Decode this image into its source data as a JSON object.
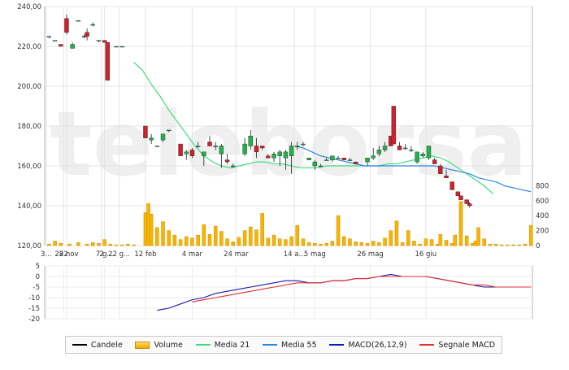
{
  "chart_data": {
    "type": "candlestick",
    "watermark": "teleborsa",
    "colors": {
      "up": "#22b24c",
      "down": "#d0202a",
      "volume_fill": "#f7b500",
      "media21": "#3ddc84",
      "media55": "#2e86de",
      "macd": "#1a1aa6",
      "signal": "#e03030"
    },
    "price_axis": {
      "min": 120,
      "max": 240,
      "ticks": [
        "120,00",
        "140,00",
        "160,00",
        "180,00",
        "200,00",
        "220,00",
        "240,00"
      ]
    },
    "volume_axis": {
      "min": 0,
      "max": 1000,
      "ticks": [
        "0",
        "200",
        "400",
        "600",
        "800"
      ]
    },
    "macd_axis": {
      "min": -20,
      "max": 5,
      "ticks": [
        "5",
        "0",
        "-5",
        "-10",
        "-15",
        "-20"
      ]
    },
    "x_labels": [
      "3...",
      "22",
      "28 nov",
      "2",
      "7 g...",
      "22 g...",
      "12 feb",
      "4 mar",
      "24 mar",
      "14 a...",
      "5 mag",
      "26 mag",
      "16 giu"
    ],
    "x_label_index": [
      0,
      6,
      7,
      19,
      20,
      25,
      34,
      50,
      65,
      85,
      92,
      111,
      130
    ],
    "num_sessions": 146,
    "candles": [
      [
        1,
        225,
        225,
        224,
        225
      ],
      [
        3,
        223,
        223,
        223,
        223
      ],
      [
        5,
        221,
        221,
        220,
        220
      ],
      [
        7,
        234,
        236,
        226,
        227
      ],
      [
        9,
        219,
        222,
        219,
        221
      ],
      [
        11,
        233,
        233,
        233,
        233
      ],
      [
        13,
        225,
        226,
        224,
        225
      ],
      [
        14,
        227,
        229,
        223,
        225
      ],
      [
        16,
        231,
        232,
        230,
        231
      ],
      [
        18,
        223,
        223,
        222,
        223
      ],
      [
        20,
        223,
        223,
        222,
        222
      ],
      [
        21,
        222,
        222,
        203,
        203
      ],
      [
        24,
        220,
        220,
        220,
        220
      ],
      [
        26,
        220,
        220,
        220,
        220
      ],
      [
        34,
        180,
        180,
        174,
        174
      ],
      [
        36,
        173,
        176,
        171,
        174
      ],
      [
        38,
        170,
        170,
        170,
        170
      ],
      [
        40,
        173,
        176,
        172,
        176
      ],
      [
        42,
        178,
        178,
        177,
        178
      ],
      [
        46,
        171,
        171,
        165,
        165
      ],
      [
        48,
        166,
        168,
        163,
        167
      ],
      [
        50,
        168,
        169,
        164,
        165
      ],
      [
        52,
        170,
        172,
        169,
        170
      ],
      [
        54,
        165,
        167,
        160,
        167
      ],
      [
        56,
        172,
        175,
        170,
        170
      ],
      [
        58,
        170,
        172,
        168,
        170
      ],
      [
        60,
        166,
        171,
        159,
        170
      ],
      [
        62,
        163,
        166,
        161,
        162
      ],
      [
        64,
        160,
        161,
        159,
        160
      ],
      [
        68,
        166,
        174,
        165,
        171
      ],
      [
        70,
        170,
        178,
        168,
        175
      ],
      [
        72,
        170,
        174,
        164,
        167
      ],
      [
        74,
        170,
        170,
        168,
        169
      ],
      [
        76,
        165,
        166,
        164,
        164
      ],
      [
        78,
        164,
        167,
        162,
        166
      ],
      [
        80,
        165,
        168,
        160,
        167
      ],
      [
        82,
        164,
        168,
        158,
        167
      ],
      [
        84,
        165,
        172,
        156,
        170
      ],
      [
        86,
        170,
        172,
        168,
        170
      ],
      [
        88,
        171,
        172,
        170,
        171
      ],
      [
        90,
        163,
        164,
        163,
        164
      ],
      [
        92,
        160,
        163,
        158,
        162
      ],
      [
        94,
        160,
        161,
        160,
        160
      ],
      [
        96,
        163,
        164,
        163,
        163
      ],
      [
        98,
        163,
        165,
        162,
        165
      ],
      [
        100,
        164,
        165,
        164,
        164
      ],
      [
        102,
        164,
        164,
        163,
        163
      ],
      [
        104,
        163,
        164,
        163,
        163
      ],
      [
        106,
        162,
        162,
        161,
        161
      ],
      [
        110,
        162,
        164,
        160,
        164
      ],
      [
        112,
        164,
        169,
        163,
        165
      ],
      [
        114,
        166,
        170,
        165,
        168
      ],
      [
        116,
        168,
        172,
        167,
        170
      ],
      [
        118,
        175,
        175,
        170,
        170
      ],
      [
        119,
        190,
        190,
        171,
        171
      ],
      [
        121,
        170,
        172,
        168,
        168
      ],
      [
        123,
        169,
        171,
        168,
        169
      ],
      [
        125,
        168,
        170,
        167,
        168
      ],
      [
        127,
        162,
        167,
        161,
        167
      ],
      [
        129,
        165,
        167,
        164,
        166
      ],
      [
        131,
        164,
        170,
        163,
        170
      ],
      [
        133,
        163,
        164,
        161,
        161
      ],
      [
        135,
        160,
        161,
        156,
        156
      ],
      [
        137,
        155,
        158,
        154,
        154
      ],
      [
        139,
        152,
        152,
        148,
        148
      ],
      [
        141,
        147,
        147,
        145,
        145
      ],
      [
        142,
        145,
        145,
        143,
        143
      ],
      [
        144,
        143,
        143,
        141,
        141
      ],
      [
        145,
        141,
        142,
        139,
        140
      ]
    ],
    "volumes": [
      [
        1,
        20
      ],
      [
        3,
        60
      ],
      [
        5,
        30
      ],
      [
        8,
        20
      ],
      [
        11,
        40
      ],
      [
        14,
        20
      ],
      [
        16,
        40
      ],
      [
        18,
        30
      ],
      [
        20,
        80
      ],
      [
        22,
        20
      ],
      [
        24,
        10
      ],
      [
        26,
        10
      ],
      [
        28,
        20
      ],
      [
        30,
        10
      ],
      [
        34,
        440
      ],
      [
        35,
        560
      ],
      [
        36,
        420
      ],
      [
        38,
        240
      ],
      [
        40,
        320
      ],
      [
        42,
        200
      ],
      [
        44,
        140
      ],
      [
        46,
        80
      ],
      [
        48,
        120
      ],
      [
        50,
        100
      ],
      [
        52,
        140
      ],
      [
        54,
        280
      ],
      [
        56,
        150
      ],
      [
        58,
        260
      ],
      [
        60,
        190
      ],
      [
        62,
        90
      ],
      [
        64,
        50
      ],
      [
        66,
        110
      ],
      [
        68,
        200
      ],
      [
        70,
        250
      ],
      [
        72,
        210
      ],
      [
        74,
        430
      ],
      [
        76,
        100
      ],
      [
        78,
        140
      ],
      [
        80,
        90
      ],
      [
        82,
        80
      ],
      [
        84,
        120
      ],
      [
        86,
        270
      ],
      [
        88,
        90
      ],
      [
        90,
        40
      ],
      [
        92,
        30
      ],
      [
        94,
        20
      ],
      [
        96,
        30
      ],
      [
        98,
        60
      ],
      [
        100,
        400
      ],
      [
        102,
        120
      ],
      [
        104,
        90
      ],
      [
        106,
        50
      ],
      [
        108,
        40
      ],
      [
        110,
        30
      ],
      [
        112,
        60
      ],
      [
        114,
        40
      ],
      [
        116,
        100
      ],
      [
        118,
        200
      ],
      [
        120,
        330
      ],
      [
        122,
        40
      ],
      [
        124,
        200
      ],
      [
        126,
        60
      ],
      [
        128,
        20
      ],
      [
        130,
        90
      ],
      [
        132,
        80
      ],
      [
        134,
        20
      ],
      [
        135,
        150
      ],
      [
        137,
        70
      ],
      [
        139,
        30
      ],
      [
        140,
        140
      ],
      [
        142,
        590
      ],
      [
        144,
        130
      ],
      [
        146,
        30
      ],
      [
        147,
        60
      ],
      [
        148,
        240
      ],
      [
        150,
        90
      ],
      [
        152,
        20
      ],
      [
        154,
        20
      ],
      [
        156,
        10
      ],
      [
        158,
        10
      ],
      [
        160,
        10
      ],
      [
        162,
        10
      ],
      [
        164,
        20
      ],
      [
        166,
        270
      ]
    ],
    "media21": [
      [
        30,
        212
      ],
      [
        33,
        208
      ],
      [
        36,
        201
      ],
      [
        39,
        195
      ],
      [
        42,
        188
      ],
      [
        45,
        182
      ],
      [
        48,
        176
      ],
      [
        51,
        170
      ],
      [
        54,
        165
      ],
      [
        57,
        162
      ],
      [
        60,
        160
      ],
      [
        63,
        159
      ],
      [
        66,
        160
      ],
      [
        69,
        161
      ],
      [
        72,
        162
      ],
      [
        75,
        162
      ],
      [
        78,
        161
      ],
      [
        81,
        161
      ],
      [
        84,
        160
      ],
      [
        87,
        159
      ],
      [
        90,
        159
      ],
      [
        93,
        159
      ],
      [
        96,
        160
      ],
      [
        99,
        160
      ],
      [
        102,
        160
      ],
      [
        105,
        160
      ],
      [
        108,
        160
      ],
      [
        111,
        160
      ],
      [
        114,
        160
      ],
      [
        117,
        161
      ],
      [
        120,
        161
      ],
      [
        123,
        162
      ],
      [
        126,
        163
      ],
      [
        129,
        164
      ],
      [
        132,
        165
      ],
      [
        135,
        164
      ],
      [
        138,
        162
      ],
      [
        141,
        159
      ],
      [
        144,
        156
      ],
      [
        147,
        153
      ],
      [
        150,
        150
      ],
      [
        153,
        146
      ]
    ],
    "media55": [
      [
        85,
        170
      ],
      [
        88,
        169
      ],
      [
        91,
        167
      ],
      [
        94,
        165
      ],
      [
        97,
        164
      ],
      [
        100,
        163
      ],
      [
        103,
        162
      ],
      [
        106,
        161
      ],
      [
        109,
        160
      ],
      [
        112,
        160
      ],
      [
        115,
        160
      ],
      [
        118,
        160
      ],
      [
        121,
        160
      ],
      [
        124,
        160
      ],
      [
        127,
        160
      ],
      [
        130,
        160
      ],
      [
        133,
        160
      ],
      [
        136,
        159
      ],
      [
        139,
        158
      ],
      [
        142,
        157
      ],
      [
        145,
        156
      ],
      [
        148,
        154
      ],
      [
        151,
        153
      ],
      [
        154,
        152
      ],
      [
        157,
        150
      ],
      [
        160,
        149
      ],
      [
        163,
        148
      ],
      [
        166,
        147
      ]
    ],
    "macd": [
      [
        38,
        -16
      ],
      [
        42,
        -15
      ],
      [
        46,
        -13
      ],
      [
        50,
        -11
      ],
      [
        54,
        -10
      ],
      [
        58,
        -8
      ],
      [
        62,
        -7
      ],
      [
        66,
        -6
      ],
      [
        70,
        -5
      ],
      [
        74,
        -4
      ],
      [
        78,
        -3
      ],
      [
        82,
        -2
      ],
      [
        86,
        -2
      ],
      [
        90,
        -3
      ],
      [
        94,
        -3
      ],
      [
        98,
        -2
      ],
      [
        102,
        -2
      ],
      [
        106,
        -1
      ],
      [
        110,
        -1
      ],
      [
        114,
        0
      ],
      [
        118,
        1
      ],
      [
        122,
        0
      ],
      [
        126,
        0
      ],
      [
        130,
        0
      ],
      [
        134,
        -1
      ],
      [
        138,
        -2
      ],
      [
        142,
        -3
      ],
      [
        146,
        -4
      ],
      [
        150,
        -5
      ],
      [
        154,
        -5
      ],
      [
        158,
        -5
      ],
      [
        162,
        -5
      ],
      [
        166,
        -5
      ]
    ],
    "signal": [
      [
        50,
        -12
      ],
      [
        54,
        -11
      ],
      [
        58,
        -10
      ],
      [
        62,
        -9
      ],
      [
        66,
        -8
      ],
      [
        70,
        -7
      ],
      [
        74,
        -6
      ],
      [
        78,
        -5
      ],
      [
        82,
        -4
      ],
      [
        86,
        -3
      ],
      [
        90,
        -3
      ],
      [
        94,
        -3
      ],
      [
        98,
        -2
      ],
      [
        102,
        -2
      ],
      [
        106,
        -1
      ],
      [
        110,
        -1
      ],
      [
        114,
        0
      ],
      [
        118,
        0
      ],
      [
        122,
        0
      ],
      [
        126,
        0
      ],
      [
        130,
        0
      ],
      [
        134,
        -1
      ],
      [
        138,
        -2
      ],
      [
        142,
        -3
      ],
      [
        146,
        -4
      ],
      [
        150,
        -4
      ],
      [
        154,
        -5
      ],
      [
        158,
        -5
      ],
      [
        162,
        -5
      ],
      [
        166,
        -5
      ]
    ]
  },
  "legend": [
    {
      "label": "Candele",
      "kind": "line",
      "color": "#000000"
    },
    {
      "label": "Volume",
      "kind": "bar",
      "color": "#f7b500"
    },
    {
      "label": "Media 21",
      "kind": "line",
      "color": "#3ddc84"
    },
    {
      "label": "Media 55",
      "kind": "line",
      "color": "#2e86de"
    },
    {
      "label": "MACD(26,12,9)",
      "kind": "line",
      "color": "#1a1aa6"
    },
    {
      "label": "Segnale MACD",
      "kind": "line",
      "color": "#e03030"
    }
  ]
}
